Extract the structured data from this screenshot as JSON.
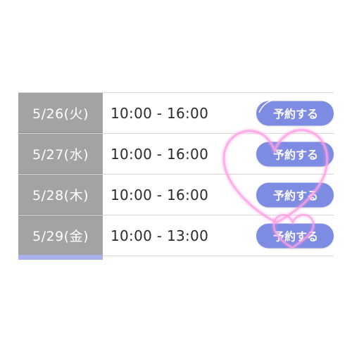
{
  "schedule": {
    "rows": [
      {
        "date": "5/26(火)",
        "time": "10:00 - 16:00",
        "button": "予約する"
      },
      {
        "date": "5/27(水)",
        "time": "10:00 - 16:00",
        "button": "予約する"
      },
      {
        "date": "5/28(木)",
        "time": "10:00 - 16:00",
        "button": "予約する"
      },
      {
        "date": "5/29(金)",
        "time": "10:00 - 13:00",
        "button": "予約する"
      }
    ]
  },
  "colors": {
    "date_cell": "#a3a3a3",
    "button": "#7d8be3",
    "accent_bar": "#a9b1ec",
    "heart": "#ff9fe2"
  },
  "decoration": {
    "icon": "heart-sparkle-icon"
  }
}
